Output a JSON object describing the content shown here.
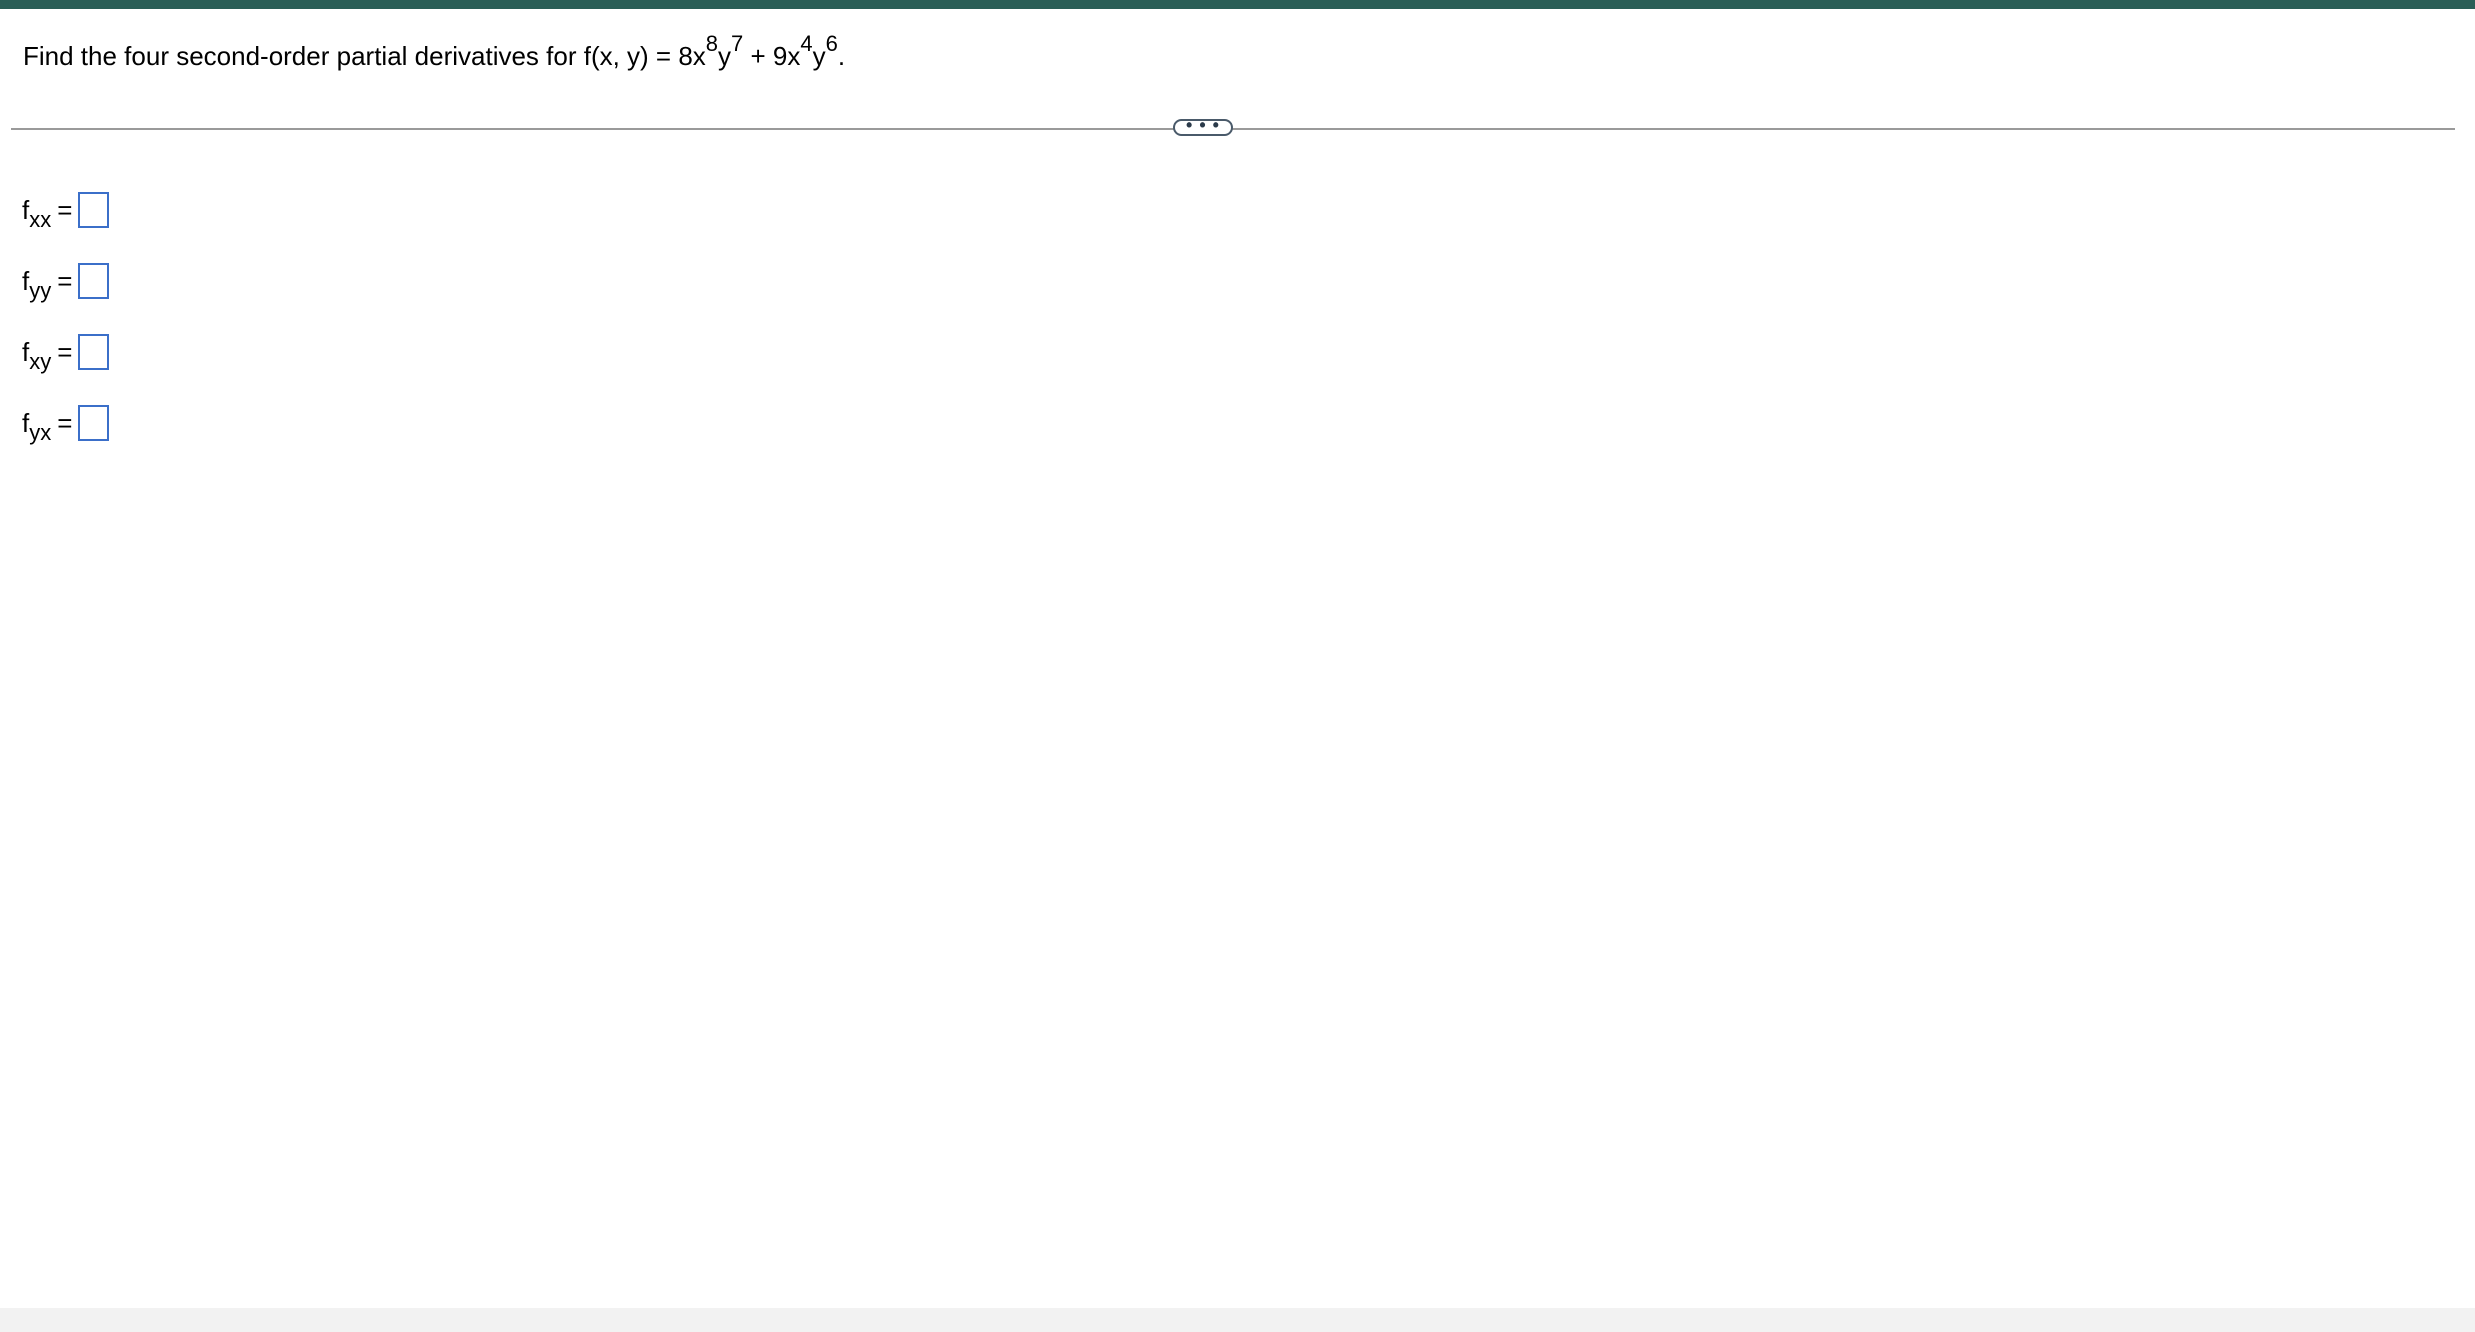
{
  "colors": {
    "top_bar": "#2b5e57",
    "answer_box_border": "#3b6fc9",
    "divider": "#9a9a9a",
    "footer": "#f2f2f2"
  },
  "question": {
    "text_before": "Find the four second-order partial derivatives for f(x, y) = 8x",
    "exp1": "8",
    "text_y1": "y",
    "exp2": "7",
    "text_mid": " + 9x",
    "exp3": "4",
    "text_y2": "y",
    "exp4": "6",
    "text_end": "."
  },
  "more_button": {
    "label": "• • •",
    "icon": "ellipsis-icon"
  },
  "answers": [
    {
      "f": "f",
      "sub": "xx",
      "eq": "=",
      "value": ""
    },
    {
      "f": "f",
      "sub": "yy",
      "eq": "=",
      "value": ""
    },
    {
      "f": "f",
      "sub": "xy",
      "eq": "=",
      "value": ""
    },
    {
      "f": "f",
      "sub": "yx",
      "eq": "=",
      "value": ""
    }
  ]
}
